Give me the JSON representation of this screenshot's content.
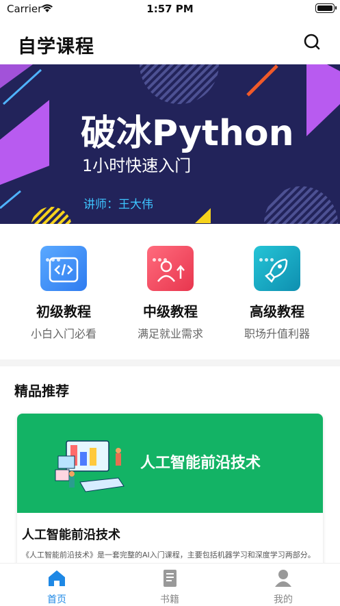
{
  "status_bar": {
    "carrier": "Carrier",
    "time": "1:57 PM"
  },
  "header": {
    "title": "自学课程",
    "search_icon": "search-icon"
  },
  "banner": {
    "title": "破冰Python",
    "subtitle": "1小时快速入门",
    "lecturer": "讲师：王大伟",
    "bg_color": "#22235a"
  },
  "categories": [
    {
      "title": "初级教程",
      "subtitle": "小白入门必看",
      "icon": "code-icon",
      "color": "#3d8cf5"
    },
    {
      "title": "中级教程",
      "subtitle": "满足就业需求",
      "icon": "user-upgrade-icon",
      "color": "#f0425a"
    },
    {
      "title": "高级教程",
      "subtitle": "职场升值利器",
      "icon": "rocket-icon",
      "color": "#14a9c2"
    }
  ],
  "featured": {
    "section_title": "精品推荐",
    "card": {
      "hero_text": "人工智能前沿技术",
      "title": "人工智能前沿技术",
      "description": "《人工智能前沿技术》是一套完整的AI入门课程，主要包括机器学习和深度学习两部分。",
      "hero_color": "#13b365"
    }
  },
  "tab_bar": {
    "active_color": "#1e88e5",
    "tabs": [
      {
        "label": "首页",
        "icon": "home-icon",
        "active": true
      },
      {
        "label": "书籍",
        "icon": "book-icon",
        "active": false
      },
      {
        "label": "我的",
        "icon": "profile-icon",
        "active": false
      }
    ]
  }
}
